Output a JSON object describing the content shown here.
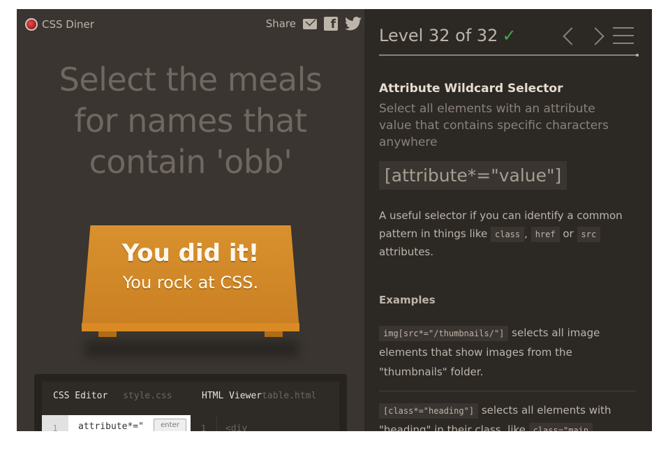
{
  "app": {
    "logo_text": "CSS Diner",
    "share_label": "Share",
    "share_icons": [
      "mail-icon",
      "facebook-icon",
      "twitter-icon"
    ]
  },
  "game": {
    "instruction_lines": [
      "Select the meals",
      "for names that",
      "contain 'obb'"
    ],
    "win_title": "You did it!",
    "win_subtitle": "You rock at CSS."
  },
  "editor": {
    "css_title": "CSS Editor",
    "css_file": "style.css",
    "html_title": "HTML Viewer",
    "html_file": "table.html",
    "css_line_number": "1",
    "css_input_value": "attribute*=\"",
    "enter_label": "enter",
    "html_line_number": "1",
    "html_code": "<div"
  },
  "sidebar": {
    "level_text": "Level 32 of 32",
    "level_complete_icon": "checkmark-icon",
    "selector_name": "Attribute Wildcard Selector",
    "selector_title": "Select all elements with an attribute value that contains specific characters anywhere",
    "syntax": "[attribute*=\"value\"]",
    "hint_prefix": "A useful selector if you can identify a common pattern in things like",
    "hint_tag1": "class",
    "hint_sep": ",",
    "hint_tag2": "href",
    "hint_or": "or",
    "hint_tag3": "src",
    "hint_suffix": "attributes.",
    "examples_title": "Examples",
    "example1_code": "img[src*=\"/thumbnails/\"]",
    "example1_text": "selects all image elements that show images from the \"thumbnails\" folder.",
    "example2_code": "[class*=\"heading\"]",
    "example2_text": "selects all elements with \"heading\" in their class, like",
    "example2_tag": "class=\"main"
  },
  "colors": {
    "left_bg": "#3a3530",
    "right_bg": "#2c2824",
    "table": "#d9912e",
    "accent_green": "#3fae49"
  }
}
